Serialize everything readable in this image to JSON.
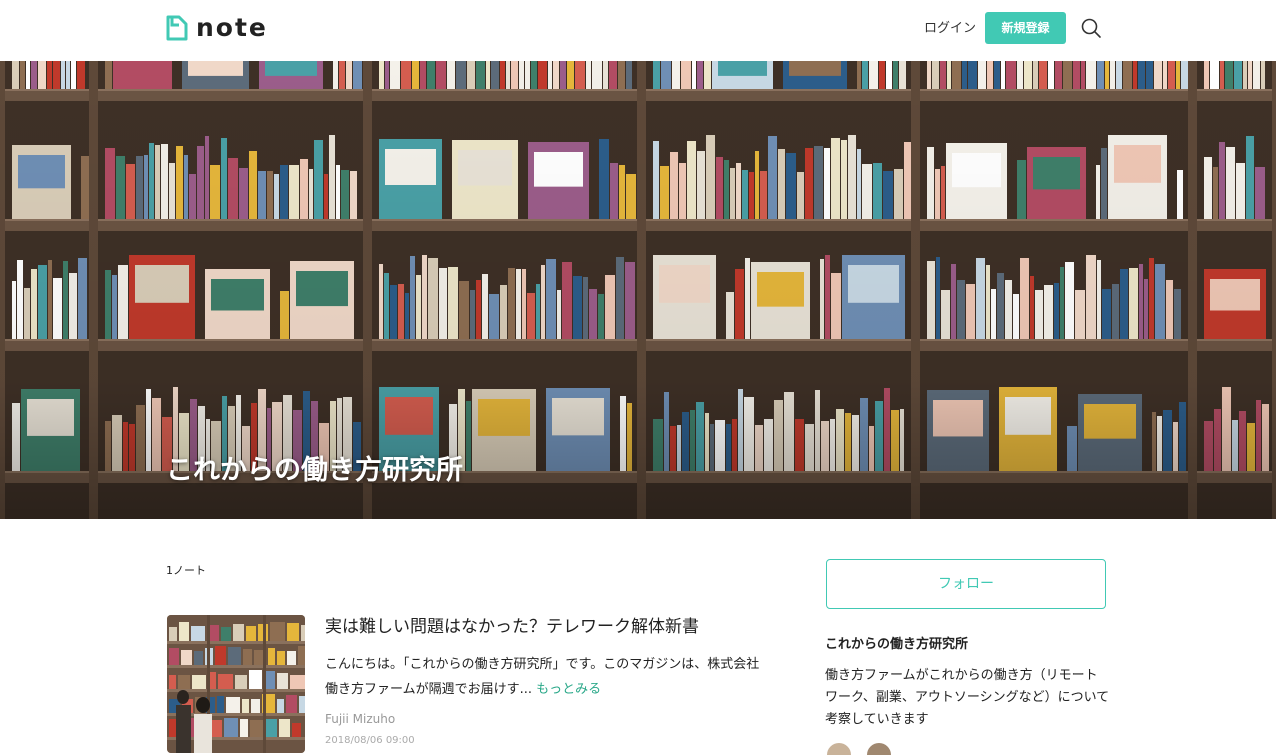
{
  "header": {
    "logo_text": "note",
    "login_label": "ログイン",
    "signup_label": "新規登録",
    "search_icon": "search-icon"
  },
  "hero": {
    "title": "これからの働き方研究所"
  },
  "magazine": {
    "note_count": "1ノート"
  },
  "article": {
    "title": "実は難しい問題はなかった？テレワーク解体新書",
    "excerpt": "こんにちは。「これからの働き方研究所」です。このマガジンは、株式会社働き方ファームが隔週でお届けす...",
    "read_more": "もっとみる",
    "author": "Fujii Mizuho",
    "date": "2018/08/06 09:00"
  },
  "sidebar": {
    "follow_label": "フォロー",
    "magazine_name": "これからの働き方研究所",
    "description": "働き方ファームがこれからの働き方（リモートワーク、副業、アウトソーシングなど）について考察していきます"
  },
  "colors": {
    "accent": "#41c9b4",
    "link": "#2aa889"
  }
}
